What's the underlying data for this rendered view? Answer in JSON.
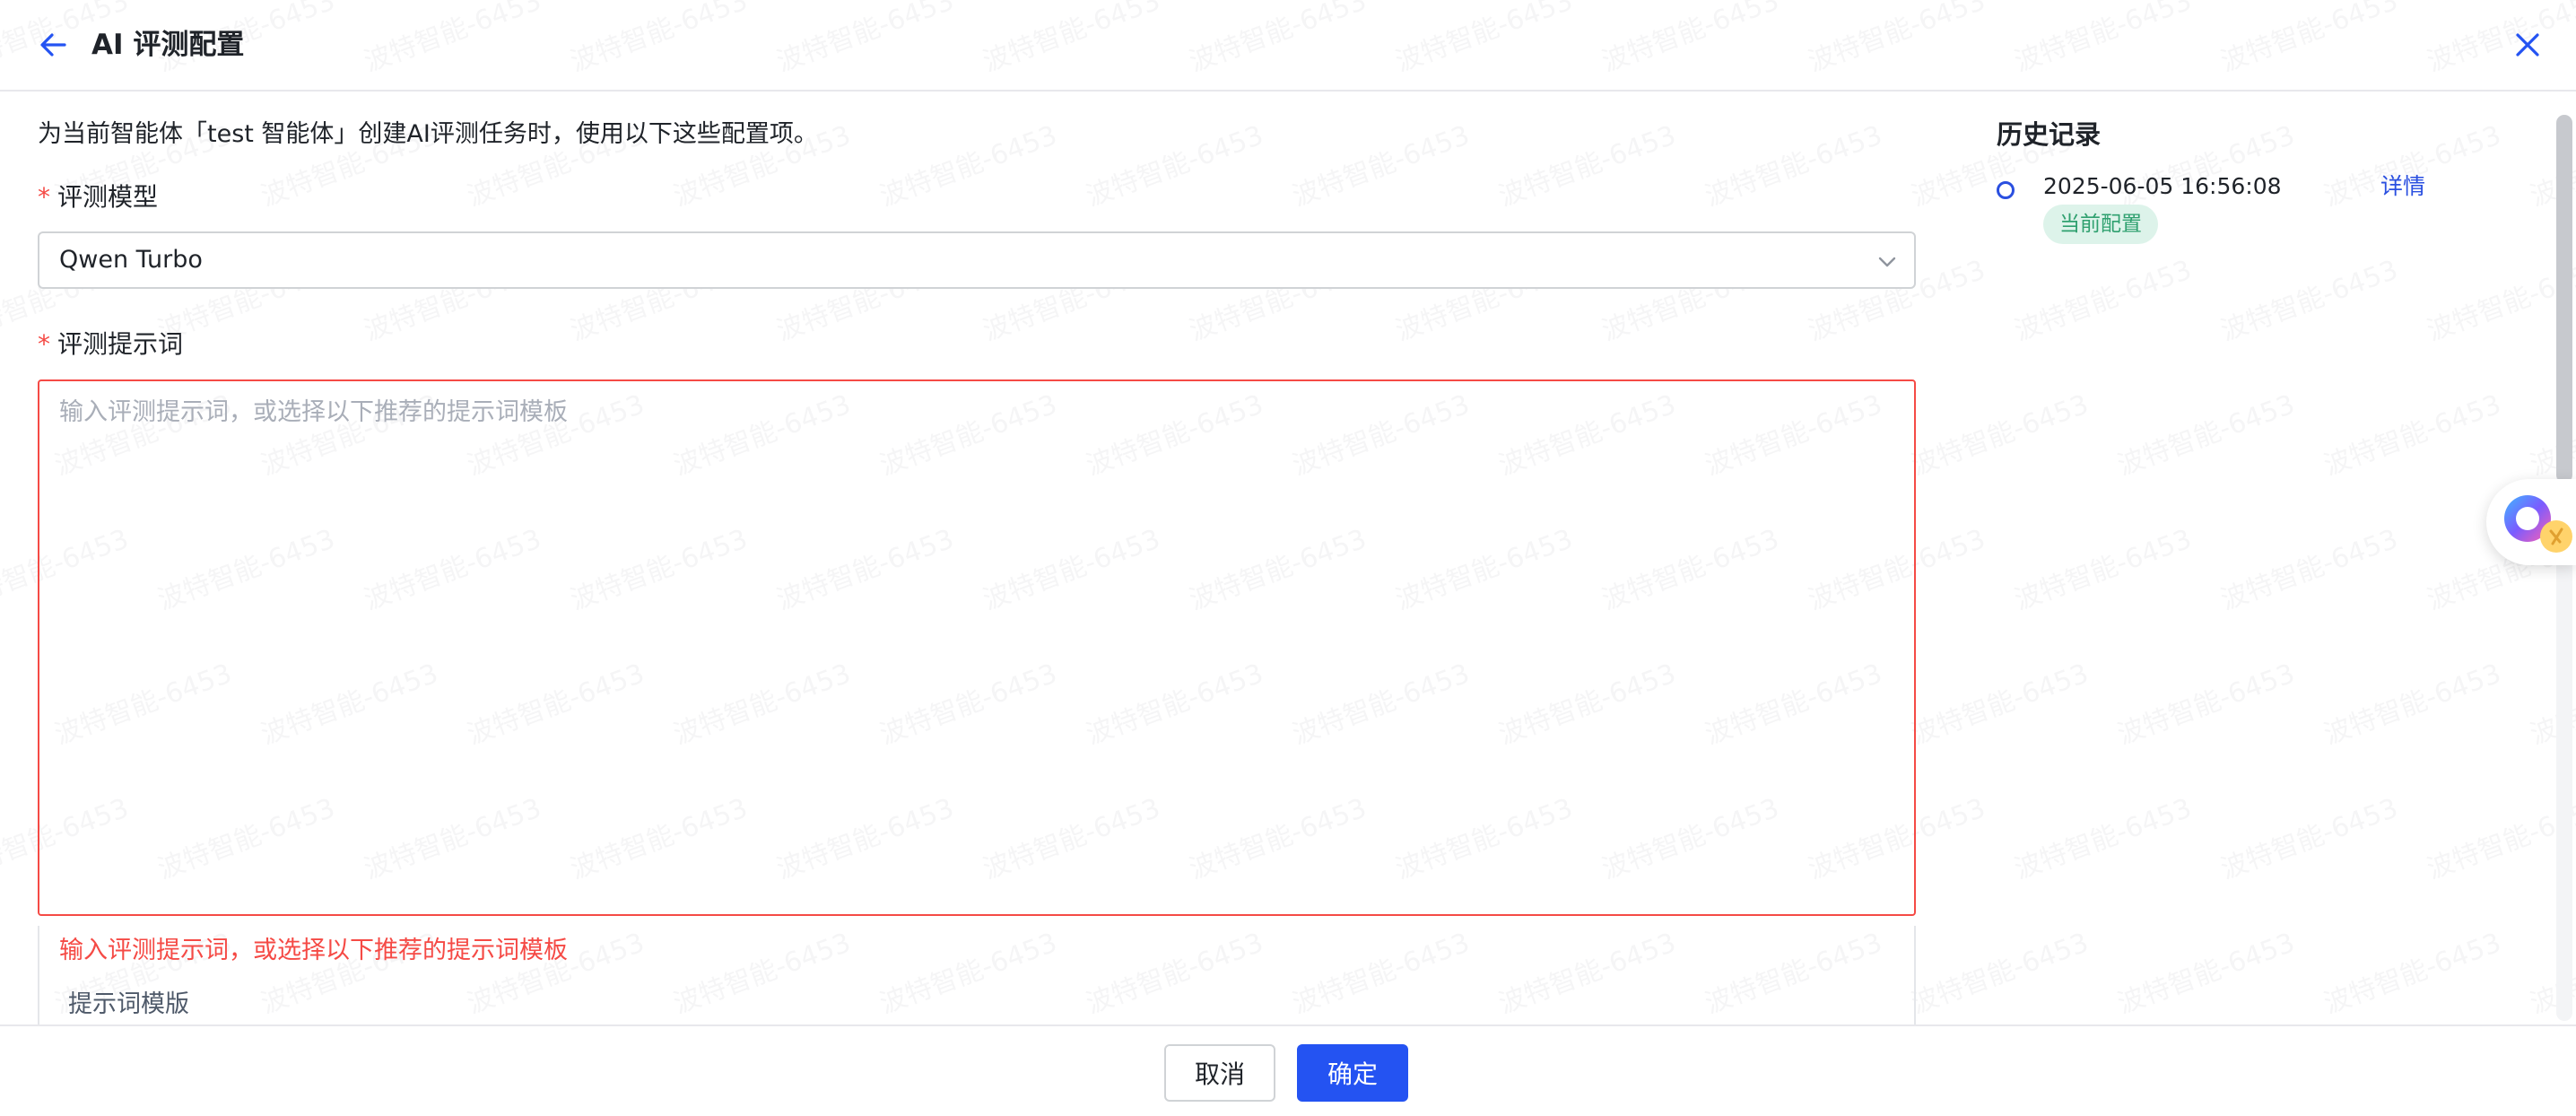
{
  "header": {
    "title": "AI 评测配置",
    "icons": {
      "back": "arrow-left-icon",
      "close": "close-icon"
    }
  },
  "form": {
    "description": "为当前智能体「test 智能体」创建AI评测任务时，使用以下这些配置项。",
    "model_label": "评测模型",
    "required_mark": "*",
    "model_value": "Qwen Turbo",
    "prompt_label": "评测提示词",
    "prompt_placeholder": "输入评测提示词，或选择以下推荐的提示词模板",
    "prompt_value": "",
    "prompt_error": "输入评测提示词，或选择以下推荐的提示词模板",
    "template_label": "提示词模版"
  },
  "history": {
    "title": "历史记录",
    "items": [
      {
        "time": "2025-06-05 16:56:08",
        "detail_label": "详情",
        "badge": "当前配置"
      }
    ]
  },
  "footer": {
    "cancel_label": "取消",
    "confirm_label": "确定"
  },
  "watermark_text": "波特智能-6453",
  "colors": {
    "primary": "#2453f2",
    "error": "#f54a45",
    "success_bg": "#ddf3ea",
    "success_text": "#2fa06f"
  }
}
